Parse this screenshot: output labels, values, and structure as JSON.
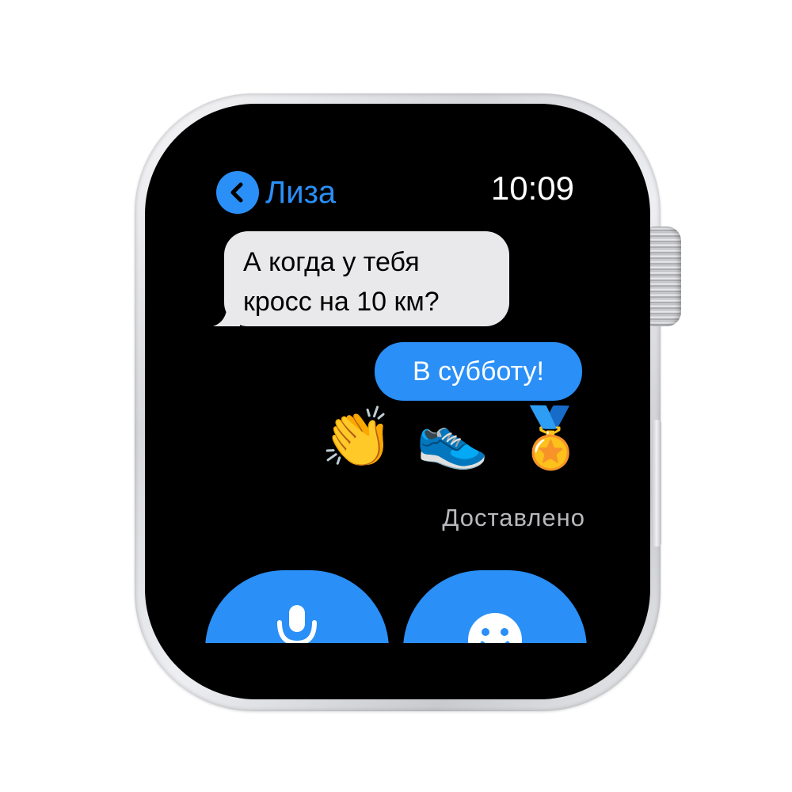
{
  "watch": {
    "header": {
      "contact_name": "Лиза",
      "time": "10:09"
    },
    "messages": {
      "incoming": [
        "А когда у тебя",
        "кросс на 10 км?"
      ],
      "outgoing": "В субботу!"
    },
    "emoji": [
      "👏",
      "👟",
      "🏅"
    ],
    "delivery_status": "Доставлено",
    "actions": [
      {
        "icon": "microphone-icon"
      },
      {
        "icon": "emoji-face-icon"
      }
    ],
    "colors": {
      "accent": "#2a8ff7",
      "incoming_bubble": "#e9e9eb",
      "status_text": "#b8b8bd"
    }
  }
}
